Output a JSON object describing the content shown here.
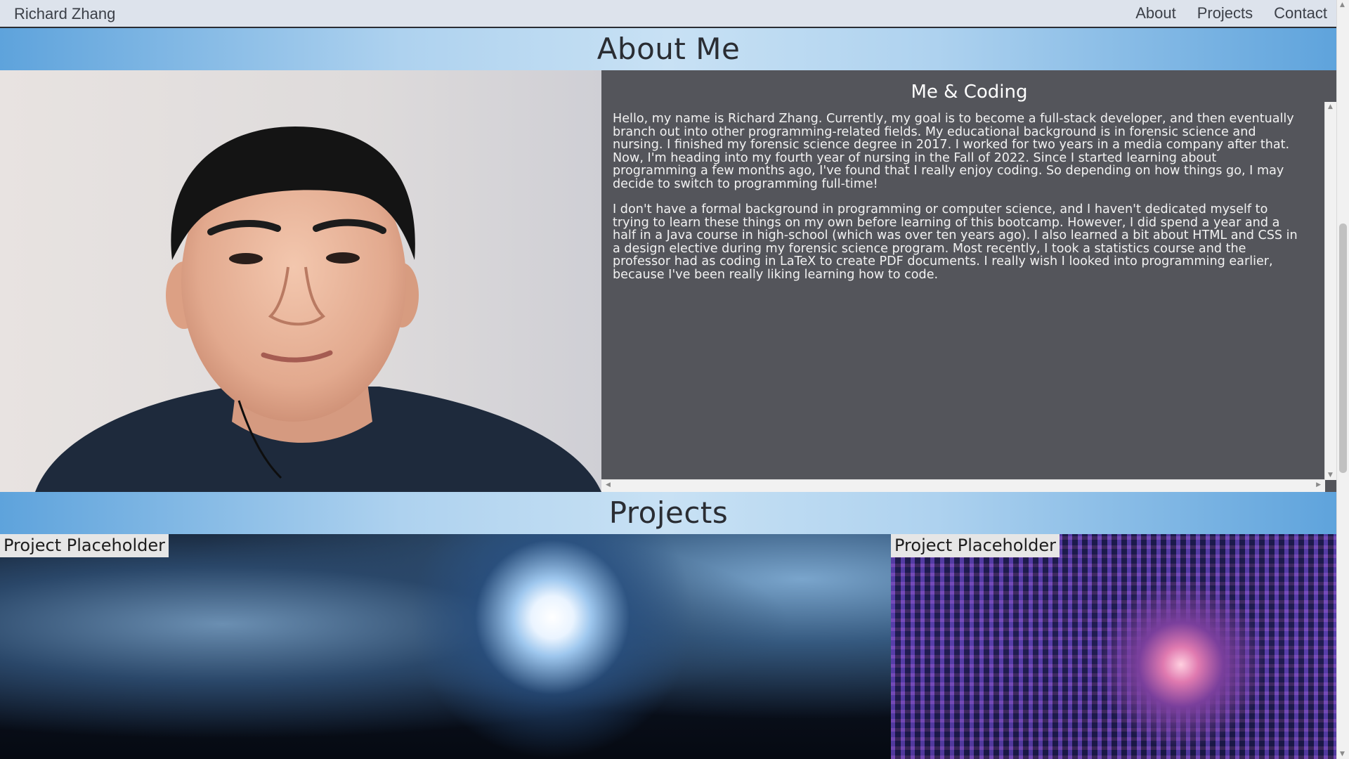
{
  "nav": {
    "brand": "Richard Zhang",
    "links": [
      "About",
      "Projects",
      "Contact"
    ]
  },
  "about": {
    "heading": "About Me",
    "photo_alt": "Portrait of Richard Zhang",
    "bio_title": "Me & Coding",
    "paragraphs": [
      "Hello, my name is Richard Zhang. Currently, my goal is to become a full-stack developer, and then eventually branch out into other programming-related fields. My educational background is in forensic science and nursing. I finished my forensic science degree in 2017. I worked for two years in a media company after that. Now, I'm heading into my fourth year of nursing in the Fall of 2022. Since I started learning about programming a few months ago, I've found that I really enjoy coding. So depending on how things go, I may decide to switch to programming full-time!",
      "I don't have a formal background in programming or computer science, and I haven't dedicated myself to trying to learn these things on my own before learning of this bootcamp. However, I did spend a year and a half in a Java course in high-school (which was over ten years ago). I also learned a bit about HTML and CSS in a design elective during my forensic science program. Most recently, I took a statistics course and the professor had as coding in LaTeX to create PDF documents. I really wish I looked into programming earlier, because I've been really liking learning how to code."
    ]
  },
  "projects": {
    "heading": "Projects",
    "items": [
      {
        "label": "Project Placeholder"
      },
      {
        "label": "Project Placeholder"
      }
    ]
  },
  "colors": {
    "nav_bg": "#dde3ec",
    "header_gradient_edge": "#5ea3dc",
    "header_gradient_center": "#c8e1f4",
    "bio_bg": "#54555b"
  }
}
